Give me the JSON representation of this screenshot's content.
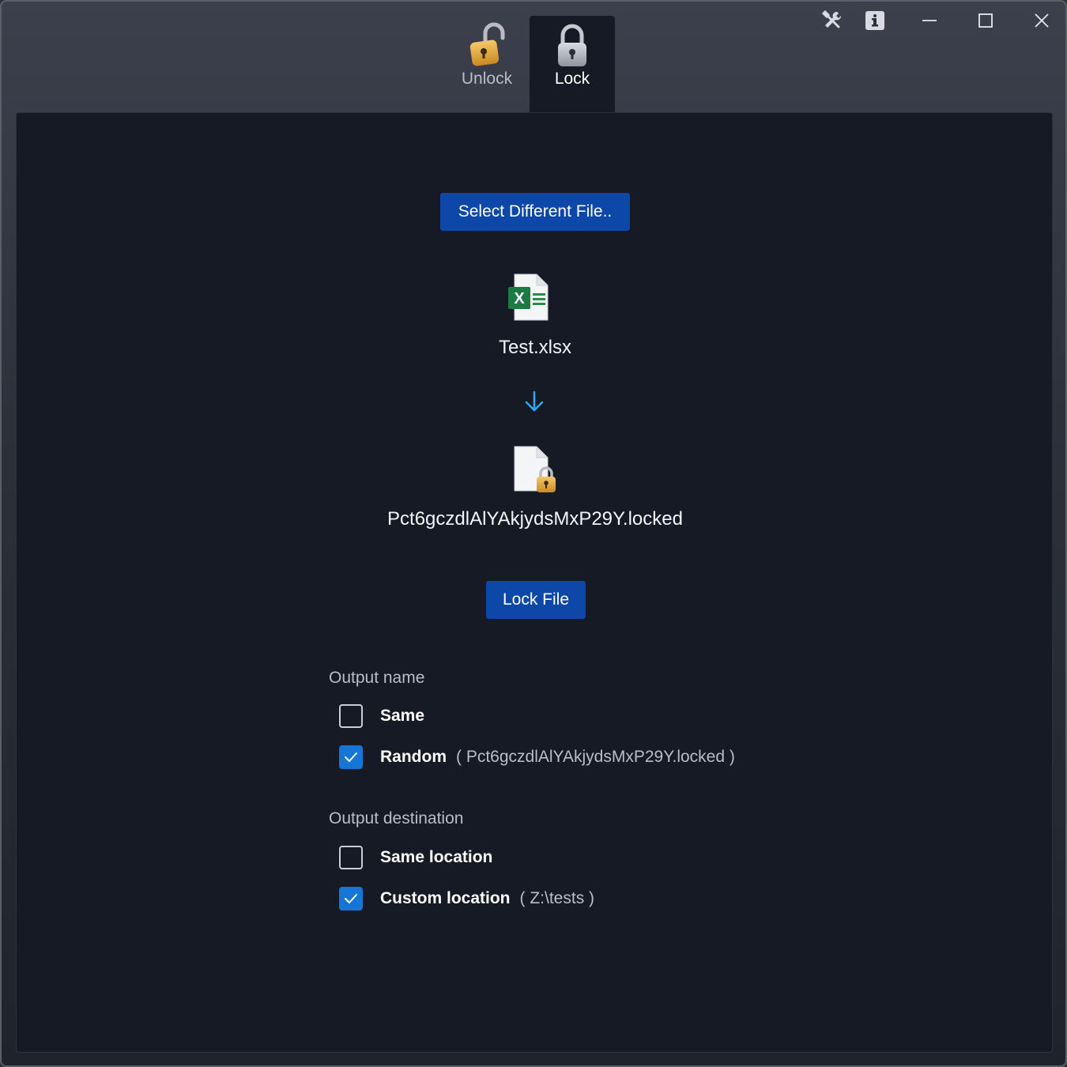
{
  "tabs": [
    {
      "label": "Unlock",
      "icon": "unlocked-padlock-icon",
      "active": false
    },
    {
      "label": "Lock",
      "icon": "locked-padlock-icon",
      "active": true
    }
  ],
  "window_controls": [
    "settings-tools-icon",
    "info-icon",
    "minimize-icon",
    "maximize-icon",
    "close-icon"
  ],
  "main": {
    "select_button": "Select Different File..",
    "input_file": "Test.xlsx",
    "input_file_icon": "excel-file-icon",
    "arrow_icon": "arrow-down-icon",
    "output_file_icon": "locked-file-icon",
    "output_file": "Pct6gczdlAlYAkjydsMxP29Y.locked",
    "lock_button": "Lock File"
  },
  "output_name": {
    "heading": "Output name",
    "options": [
      {
        "label": "Same",
        "checked": false,
        "detail": ""
      },
      {
        "label": "Random",
        "checked": true,
        "detail": "( Pct6gczdlAlYAkjydsMxP29Y.locked )"
      }
    ]
  },
  "output_destination": {
    "heading": "Output destination",
    "options": [
      {
        "label": "Same location",
        "checked": false,
        "detail": ""
      },
      {
        "label": "Custom location",
        "checked": true,
        "detail": "( Z:\\tests )"
      }
    ]
  },
  "colors": {
    "accent": "#0d47a8",
    "checkbox_checked": "#1576d6",
    "arrow": "#2aa8f2",
    "panel_bg": "#161a25"
  }
}
